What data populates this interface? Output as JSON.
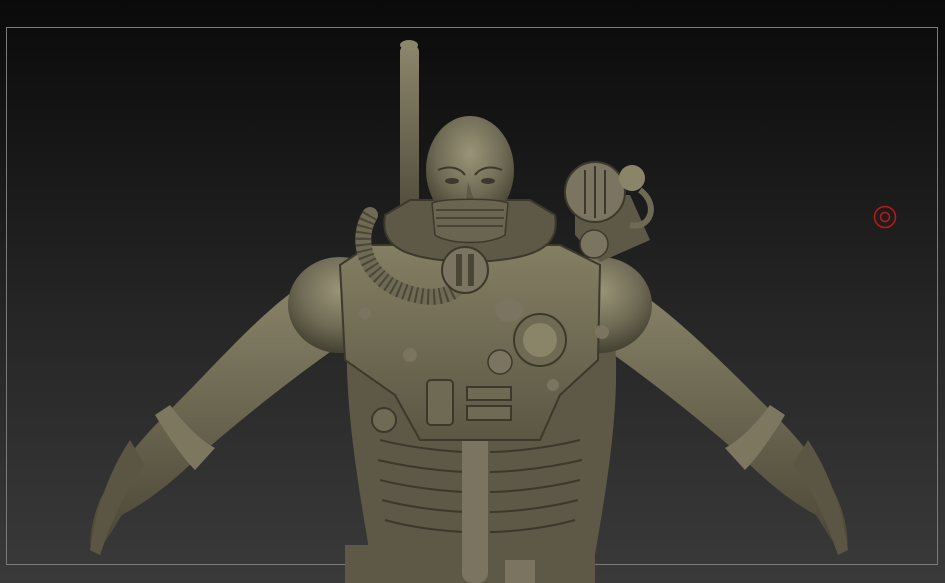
{
  "viewport": {
    "background_top": "#0a0a0a",
    "background_bottom": "#3a3a3a",
    "frame_color": "#7a7a7a"
  },
  "model": {
    "material_color": "#6f6a54",
    "highlight_color": "#9a9478",
    "shadow_color": "#3c392c",
    "icon": "sculpted-armored-soldier-bust"
  },
  "cursor": {
    "icon": "brush-cursor-icon",
    "color": "#c0181a"
  }
}
